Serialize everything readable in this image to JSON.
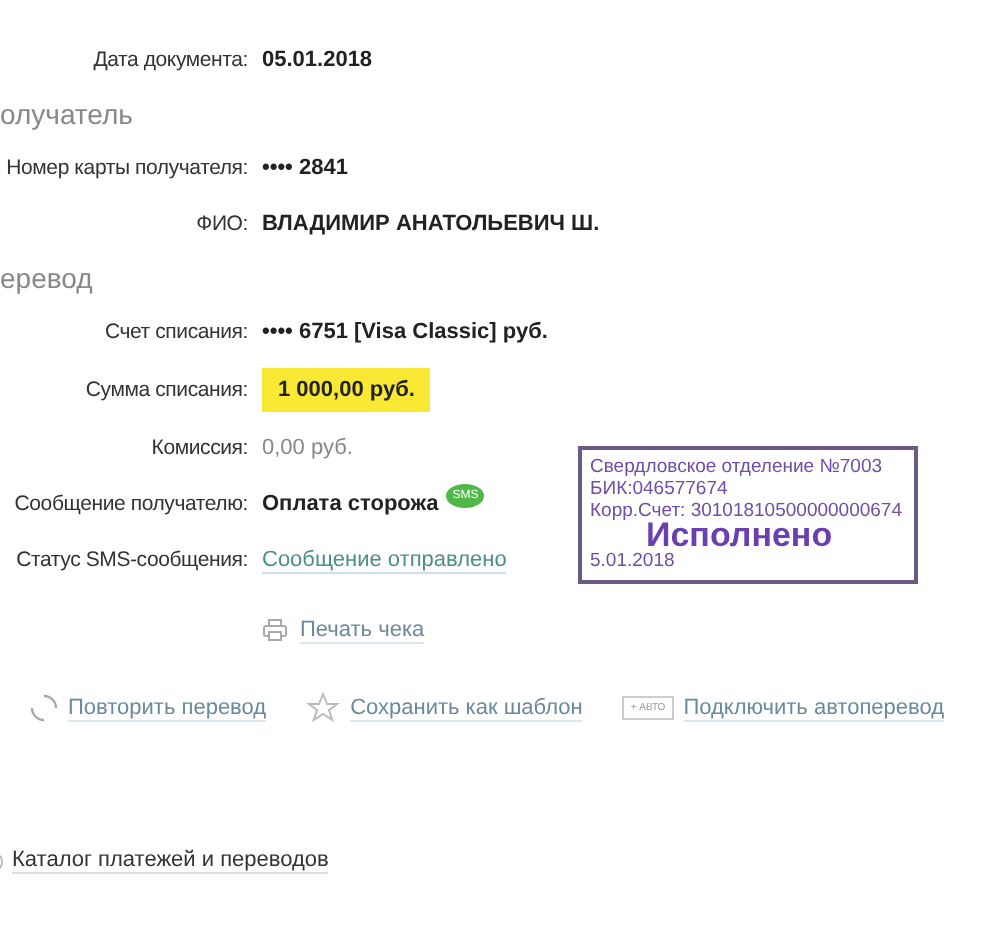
{
  "document_date": {
    "label": "Дата документа:",
    "value": "05.01.2018"
  },
  "sections": [
    {
      "title": "олучатель",
      "rows": [
        {
          "kind": "plain",
          "label": "Номер карты получателя:",
          "value": "•••• 2841"
        },
        {
          "kind": "plain",
          "label": "ФИО:",
          "value": "ВЛАДИМИР АНАТОЛЬЕВИЧ Ш."
        }
      ]
    },
    {
      "title": "еревод",
      "rows": [
        {
          "kind": "plain",
          "label": "Счет списания:",
          "value": "•••• 6751  [Visa Classic]  руб."
        },
        {
          "kind": "highlight",
          "label": "Сумма списания:",
          "value": "1 000,00  руб."
        },
        {
          "kind": "light",
          "label": "Комиссия:",
          "value": "0,00 руб."
        },
        {
          "kind": "sms",
          "label": "Сообщение получателю:",
          "value": "Оплата сторожа",
          "badge": "SMS"
        },
        {
          "kind": "status",
          "label": "Статус SMS-сообщения:",
          "value": "Сообщение отправлено"
        }
      ]
    }
  ],
  "stamp": {
    "lines": [
      "Свердловское отделение №7003",
      "БИК:046577674",
      "Корр.Счет: 30101810500000000674"
    ],
    "status": "Исполнено",
    "date": "5.01.2018"
  },
  "print_link": "Печать чека",
  "actions": [
    {
      "kind": "repeat",
      "label": "Повторить перевод"
    },
    {
      "kind": "star",
      "label": "Сохранить как шаблон"
    },
    {
      "kind": "auto",
      "label": "Подключить автоперевод",
      "tag": "+ АВТО"
    }
  ],
  "catalog_link": "Каталог платежей и переводов"
}
